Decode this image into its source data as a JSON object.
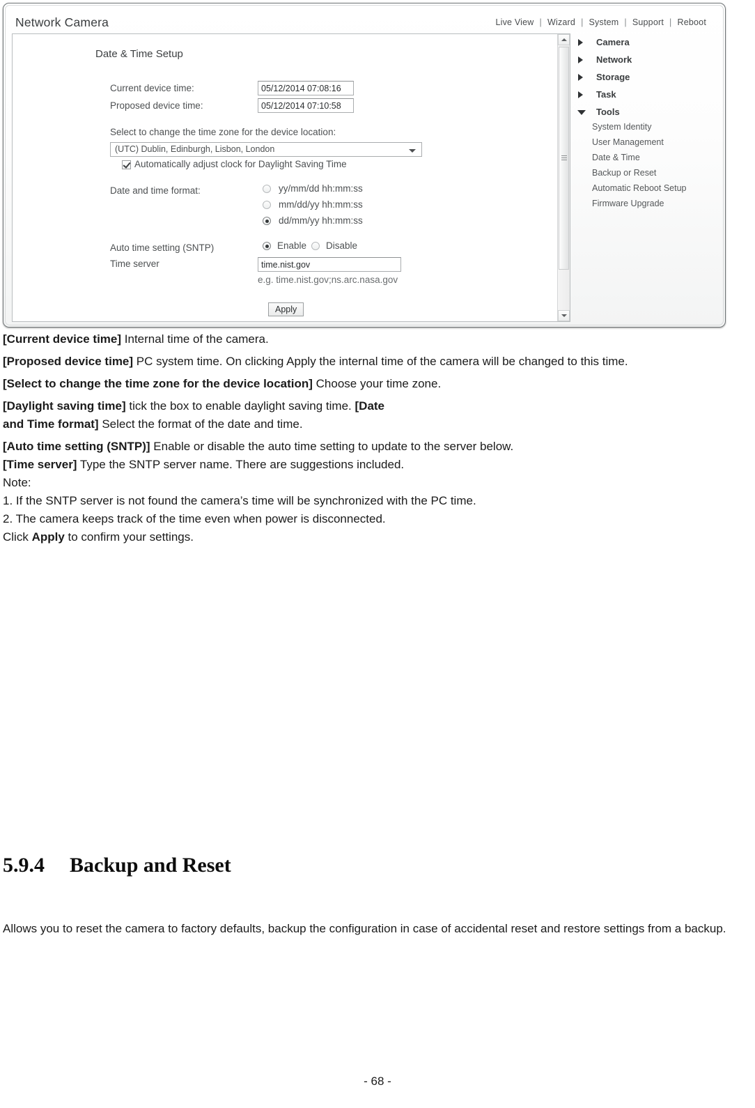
{
  "screenshot": {
    "app_title": "Network Camera",
    "topnav": [
      {
        "label": "Live View"
      },
      {
        "label": "Wizard"
      },
      {
        "label": "System"
      },
      {
        "label": "Support"
      },
      {
        "label": "Reboot"
      }
    ],
    "panel_heading": "Date & Time Setup",
    "fields": {
      "current_device_time_label": "Current device time:",
      "current_device_time_value": "05/12/2014 07:08:16",
      "proposed_device_time_label": "Proposed device time:",
      "proposed_device_time_value": "05/12/2014 07:10:58",
      "timezone_label": "Select to change the time zone for the device location:",
      "timezone_value": "(UTC) Dublin, Edinburgh, Lisbon, London",
      "dst_label": "Automatically adjust clock for Daylight Saving Time",
      "dst_checked": true,
      "format_label": "Date and time format:",
      "format_options": [
        {
          "label": "yy/mm/dd hh:mm:ss",
          "selected": false
        },
        {
          "label": "mm/dd/yy hh:mm:ss",
          "selected": false
        },
        {
          "label": "dd/mm/yy hh:mm:ss",
          "selected": true
        }
      ],
      "sntp_label": "Auto time setting (SNTP)",
      "sntp_options": [
        {
          "label": "Enable",
          "selected": true
        },
        {
          "label": "Disable",
          "selected": false
        }
      ],
      "time_server_label": "Time server",
      "time_server_value": "time.nist.gov",
      "time_server_hint": "e.g. time.nist.gov;ns.arc.nasa.gov",
      "apply_button": "Apply"
    },
    "sidemenu": {
      "top_items": [
        {
          "label": "Camera",
          "expanded": false
        },
        {
          "label": "Network",
          "expanded": false
        },
        {
          "label": "Storage",
          "expanded": false
        },
        {
          "label": "Task",
          "expanded": false
        },
        {
          "label": "Tools",
          "expanded": true
        }
      ],
      "tools_children": [
        {
          "label": "System Identity"
        },
        {
          "label": "User Management"
        },
        {
          "label": "Date & Time"
        },
        {
          "label": "Backup or Reset"
        },
        {
          "label": "Automatic Reboot Setup"
        },
        {
          "label": "Firmware Upgrade"
        }
      ]
    }
  },
  "doc": {
    "paragraphs": [
      {
        "term": "[Current device time]",
        "text": " Internal time of the camera."
      },
      {
        "term": "[Proposed device time]",
        "text": " PC system time. On clicking Apply the internal time of the camera will be changed to this time."
      },
      {
        "term": "[Select to change the time zone for the device location]",
        "text": " Choose your time zone."
      }
    ],
    "dst_line_term": "[Daylight saving time]",
    "dst_line_text": " tick the box to enable daylight saving time. ",
    "dst_line_term2": "[Date",
    "format_line_term": "and Time format]",
    "format_line_text": " Select the format of the date and time.",
    "sntp_line_term": "[Auto time setting (SNTP)]",
    "sntp_line_text": " Enable or disable the auto time setting to update to the server below.",
    "server_line_term": "[Time server]",
    "server_line_text": " Type the SNTP server name. There are suggestions included.",
    "note_label": "Note:",
    "notes": [
      "1. If the SNTP server is not found the camera’s time will be synchronized with the PC time.",
      "2. The camera keeps track of the time even when power is disconnected."
    ],
    "click_prefix": "Click ",
    "click_bold": "Apply",
    "click_suffix": " to confirm your settings.",
    "section_number": "5.9.4",
    "section_title": "Backup and Reset",
    "closing_paragraph": "Allows you to reset the camera to factory defaults, backup the configuration in case of accidental reset and restore settings from a backup.",
    "page_number": "- 68 -"
  }
}
